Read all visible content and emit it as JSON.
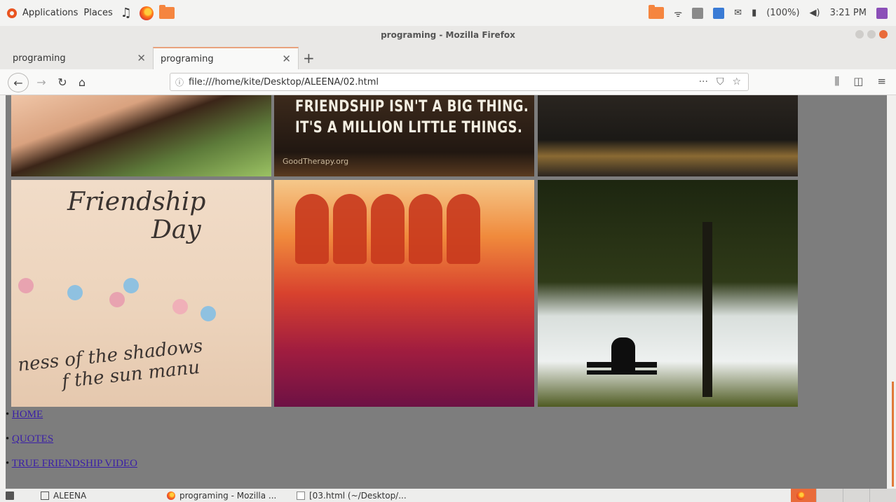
{
  "system_panel": {
    "applications_label": "Applications",
    "places_label": "Places",
    "battery_label": "(100%)",
    "clock": "3:21 PM"
  },
  "window": {
    "title": "programing - Mozilla Firefox"
  },
  "tabs": [
    {
      "label": "programing",
      "active": false
    },
    {
      "label": "programing",
      "active": true
    }
  ],
  "navbar": {
    "url": "file:///home/kite/Desktop/ALEENA/02.html",
    "page_actions_icon": "···"
  },
  "page": {
    "quote_line1": "FRIENDSHIP ISN'T A BIG THING.",
    "quote_line2": "IT'S A MILLION LITTLE THINGS.",
    "quote_credit": "GoodTherapy.org",
    "card_title_1": "Friendship",
    "card_title_2": "Day",
    "card_verse_1": "ness of the shadows",
    "card_verse_2": "f the sun   manu",
    "links": [
      {
        "label": "HOME"
      },
      {
        "label": "QUOTES"
      },
      {
        "label": "TRUE FRIENDSHIP VIDEO"
      }
    ]
  },
  "taskbar": {
    "items": [
      {
        "label": "ALEENA"
      },
      {
        "label": "programing - Mozilla ..."
      },
      {
        "label": "[03.html (~/Desktop/..."
      }
    ]
  },
  "colors": {
    "accent": "#e95420",
    "link": "#3a1fa7",
    "page_bg": "#7d7d7d"
  }
}
